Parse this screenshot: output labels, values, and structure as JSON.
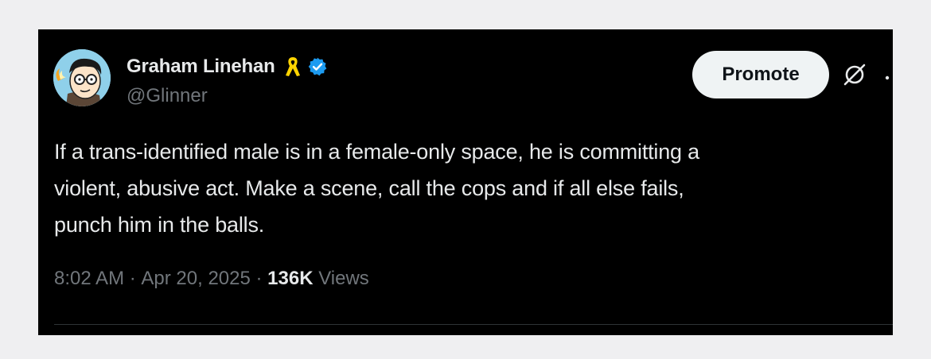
{
  "colors": {
    "page_background": "#efeff1",
    "card_background": "#000000",
    "primary_text": "#e7e9ea",
    "secondary_text": "#71767b",
    "verified_badge": "#1d9bf0",
    "ribbon": "#ffd400",
    "promote_button_bg": "#eff3f4"
  },
  "author": {
    "display_name": "Graham Linehan",
    "handle": "@Glinner",
    "avatar_icon": "cartoon-avatar",
    "badges": [
      "yellow-ribbon-icon",
      "verified-check-icon"
    ]
  },
  "actions": {
    "promote_label": "Promote",
    "grok_icon": "grok-icon",
    "more_icon": "more-icon"
  },
  "tweet": {
    "text": "If a trans-identified male is in a female-only space, he is committing a\nviolent, abusive act. Make a scene, call the cops and if all else fails,\npunch him in the balls.",
    "time": "8:02 AM",
    "separator": " · ",
    "date": "Apr 20, 2025",
    "views_count": "136K",
    "views_label": " Views"
  }
}
